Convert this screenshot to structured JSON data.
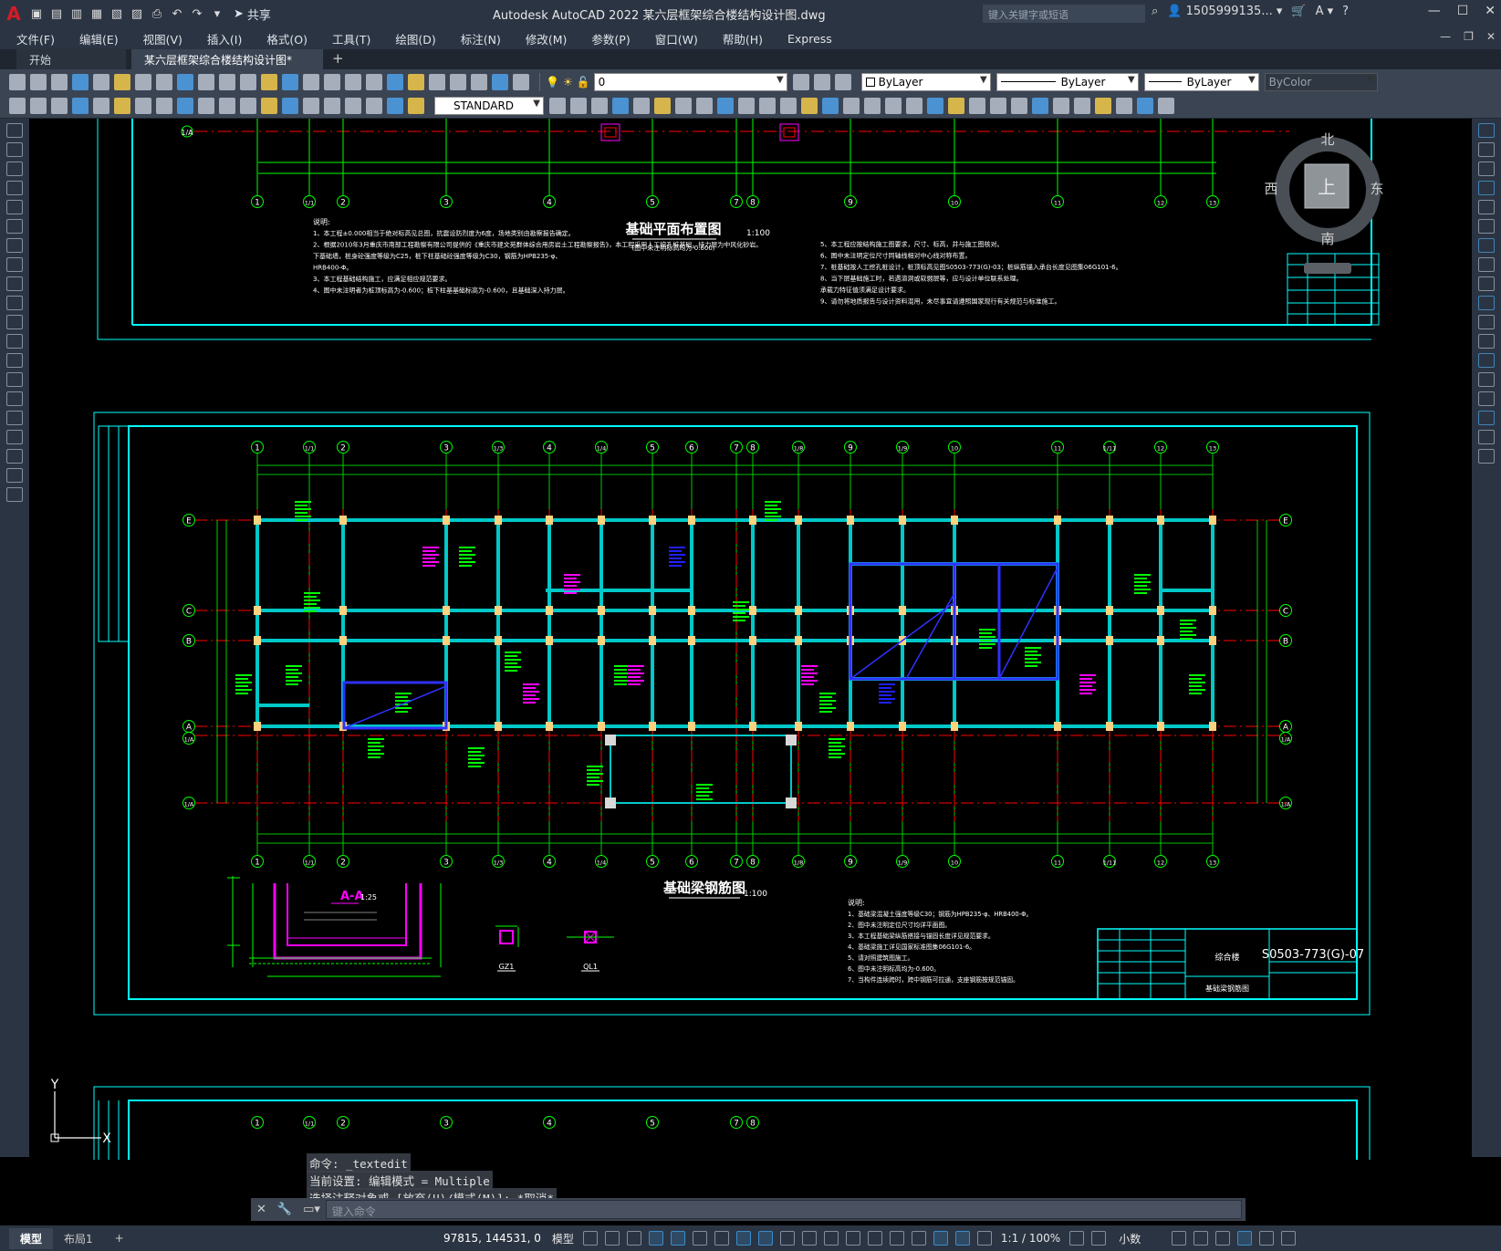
{
  "title_bar": {
    "app_letter": "A",
    "share_label": "共享",
    "title": "Autodesk AutoCAD 2022    某六层框架综合楼结构设计图.dwg",
    "search_placeholder": "键入关键字或短语",
    "user": "1505999135...",
    "help": "?"
  },
  "menu": [
    "文件(F)",
    "编辑(E)",
    "视图(V)",
    "插入(I)",
    "格式(O)",
    "工具(T)",
    "绘图(D)",
    "标注(N)",
    "修改(M)",
    "参数(P)",
    "窗口(W)",
    "帮助(H)",
    "Express"
  ],
  "doc_tabs": {
    "start": "开始",
    "active": "某六层框架综合楼结构设计图*"
  },
  "toolbar1": {
    "layer_name": "0",
    "color": "ByLayer",
    "linetype": "ByLayer",
    "lineweight": "ByLayer",
    "plotstyle": "ByColor"
  },
  "toolbar2": {
    "text_style": "STANDARD"
  },
  "viewcube": {
    "north": "北",
    "south": "南",
    "east": "东",
    "west": "西",
    "top": "上"
  },
  "drawing": {
    "top_title": "基础平面布置图",
    "top_scale": "1:100",
    "top_subnote": "(图中未注明标高均为-0.600)",
    "notes_label": "说明:",
    "top_notes_left": [
      "1、本工程±0.000相当于绝对标高见总图，抗震设防烈度为6度，场地类别由勘察报告确定。",
      "2、根据2010年3月重庆市南部工程勘察有限公司提供的《重庆市建文苑群体综合用房岩土工程勘察报告》，本工程采用人工挖孔桩基础，持力层为中风化砂岩。",
      "   下基础墙，桩身砼强度等级为C25，桩下柱基础砼强度等级为C30，钢筋为HPB235-φ、",
      "   HRB400-Φ。",
      "3、本工程基础结构施工，应满足相应规范要求。",
      "4、图中未注明者为桩顶标高为-0.600；桩下柱基基础标高为-0.600，且基础深入持力层。"
    ],
    "top_notes_right": [
      "5、本工程应按结构施工图要求，尺寸、标高，并与施工图核对。",
      "6、图中未注明定位尺寸同轴线相对中心线对称布置。",
      "7、桩基础按人工挖孔桩设计，桩顶标高见图S0503-773(G)-03；桩纵筋锚入承台长度见图集06G101-6。",
      "8、当下层基础施工时，若遇溶洞或软弱层等，应与设计单位联系处理。",
      "   承载力特征值须满足设计要求。",
      "9、请勿将地质报告与设计资料混用，未尽事宜请遵照国家现行有关规范与标准施工。"
    ],
    "main_title": "基础梁钢筋图",
    "main_scale": "1:100",
    "main_notes": [
      "1、基础梁混凝土强度等级C30；钢筋为HPB235-φ、HRB400-Φ。",
      "2、图中未注明定位尺寸均详平面图。",
      "3、本工程基础梁纵筋搭接与锚固长度详见规范要求。",
      "4、基础梁施工详见国家标准图集06G101-6。",
      "5、请对照建筑图施工。",
      "6、图中未注明标高均为-0.600。",
      "7、当构件连续跨时，跨中钢筋可拉通，支座钢筋按规范锚固。"
    ],
    "section_title": "A-A",
    "section_scale": "1:25",
    "gz_label": "GZ1",
    "ql_label": "QL1",
    "sheet_no": "S0503-773(G)-07",
    "tb_project": "综合楼",
    "tb_drawing": "基础梁钢筋图",
    "axis_numbers": [
      "1",
      "1/1",
      "2",
      "3",
      "1/3",
      "4",
      "1/4",
      "5",
      "6",
      "7",
      "8",
      "1/8",
      "9",
      "1/9",
      "10",
      "11",
      "1/11",
      "12",
      "13"
    ],
    "axis_letters": [
      "E",
      "C",
      "B",
      "A",
      "1/A"
    ]
  },
  "command": {
    "line1": "命令: _textedit",
    "line2": "当前设置: 编辑模式 = Multiple",
    "line3": "选择注释对象或 [放弃(U)/模式(M)]: *取消*",
    "placeholder": "键入命令"
  },
  "layout_tabs": [
    "模型",
    "布局1"
  ],
  "status": {
    "coords": "97815, 144531, 0",
    "model": "模型",
    "scale": "1:1 / 100%",
    "units": "小数"
  },
  "ucs": {
    "y": "Y",
    "x": "X"
  },
  "colors": {
    "frame": "#00ffff",
    "grid": "#00ff00",
    "axis_dash": "#ff0000",
    "beam": "#00c8c8",
    "highlight": "#2020ff",
    "rebar": "#ff00ff",
    "column": "#ffd27f",
    "text": "#ffffff"
  }
}
